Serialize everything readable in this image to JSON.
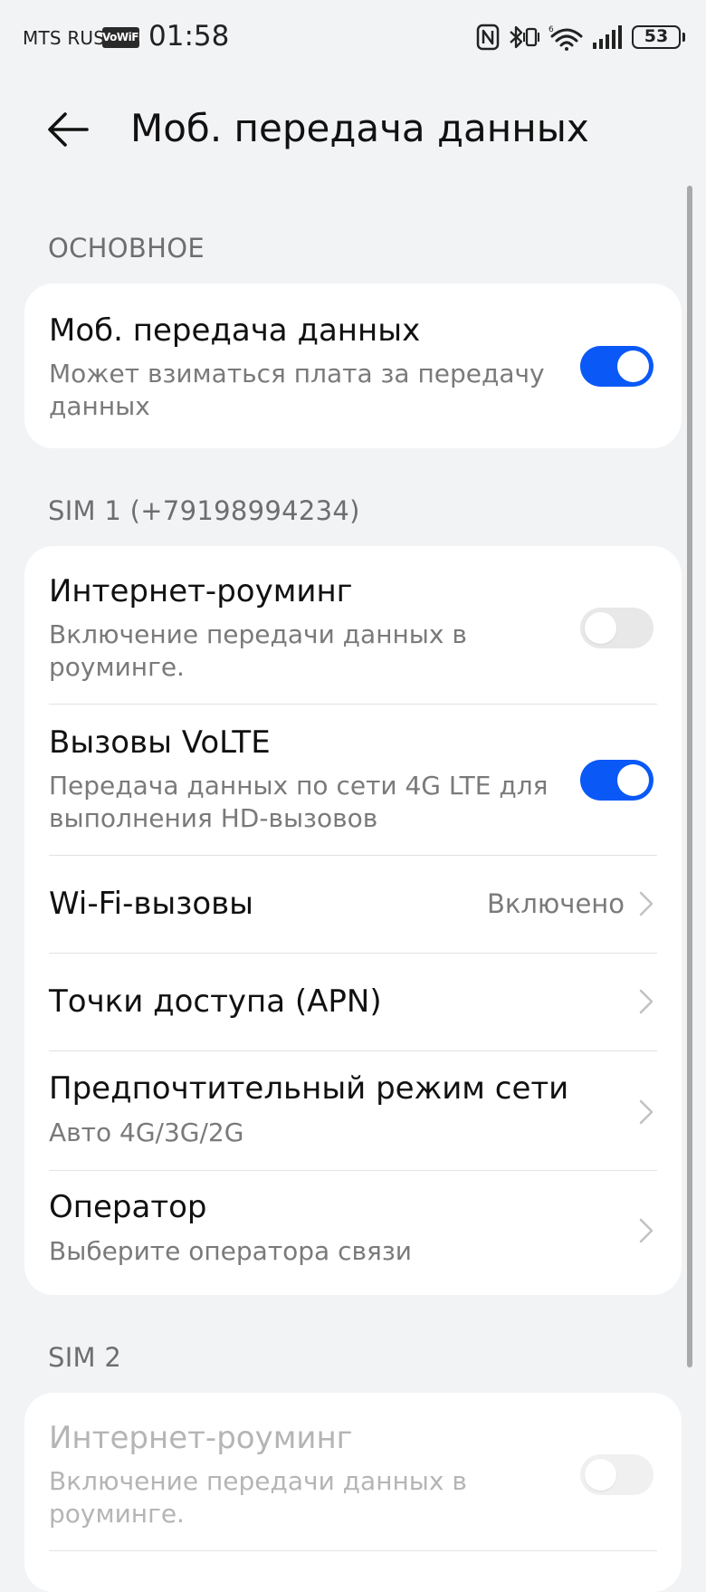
{
  "status_bar": {
    "carrier": "MTS RUS",
    "vowifi_badge": "VoWiFi",
    "time": "01:58",
    "battery": "53",
    "icons": [
      "nfc-icon",
      "bluetooth-vibrate-icon",
      "wifi-6-icon",
      "signal-icon",
      "battery-icon"
    ]
  },
  "header": {
    "title": "Моб. передача данных",
    "back_icon": "arrow-left-icon"
  },
  "sections": {
    "main": {
      "label": "ОСНОВНОЕ",
      "mobile_data": {
        "title": "Моб. передача данных",
        "subtitle": "Может взиматься плата за передачу данных",
        "enabled": true
      }
    },
    "sim1": {
      "label": "SIM 1 (+79198994234)",
      "roaming": {
        "title": "Интернет-роуминг",
        "subtitle": "Включение передачи данных в роуминге.",
        "enabled": false
      },
      "volte": {
        "title": "Вызовы VoLTE",
        "subtitle": "Передача данных по сети 4G LTE для выполнения HD-вызовов",
        "enabled": true
      },
      "wifi_calls": {
        "title": "Wi-Fi-вызовы",
        "value": "Включено"
      },
      "apn": {
        "title": "Точки доступа (APN)"
      },
      "network_mode": {
        "title": "Предпочтительный режим сети",
        "subtitle": "Авто 4G/3G/2G"
      },
      "operator": {
        "title": "Оператор",
        "subtitle": "Выберите оператора связи"
      }
    },
    "sim2": {
      "label": "SIM 2",
      "roaming": {
        "title": "Интернет-роуминг",
        "subtitle": "Включение передачи данных в роуминге.",
        "enabled": false,
        "disabled": true
      }
    }
  },
  "colors": {
    "accent": "#0a59f7",
    "background": "#f1f3f5",
    "card": "#ffffff",
    "secondary_text": "#7a7a7a"
  }
}
